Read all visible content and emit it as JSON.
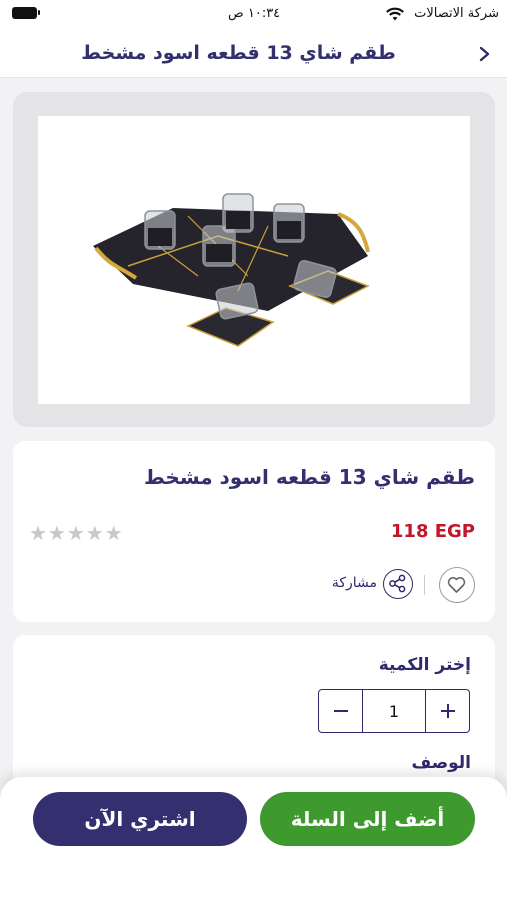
{
  "status_bar": {
    "carrier": "شركة الاتصالات",
    "time": "١٠:٣٤ ص"
  },
  "nav": {
    "title": "طقم شاي 13 قطعه اسود مشخط"
  },
  "product": {
    "title": "طقم شاي 13 قطعه اسود مشخط",
    "price": "118 EGP",
    "rating_stars": "★★★★★",
    "rating_value": 0,
    "share_label": "مشاركة"
  },
  "quantity": {
    "label": "إختر الكمية",
    "value": "1",
    "minus": "−",
    "plus": "+"
  },
  "description": {
    "label": "الوصف"
  },
  "actions": {
    "buy_now": "اشتري الآن",
    "add_to_cart": "أضف إلى السلة"
  },
  "colors": {
    "brand": "#34306f",
    "green": "#3e9a2f",
    "price": "#c4142a"
  }
}
